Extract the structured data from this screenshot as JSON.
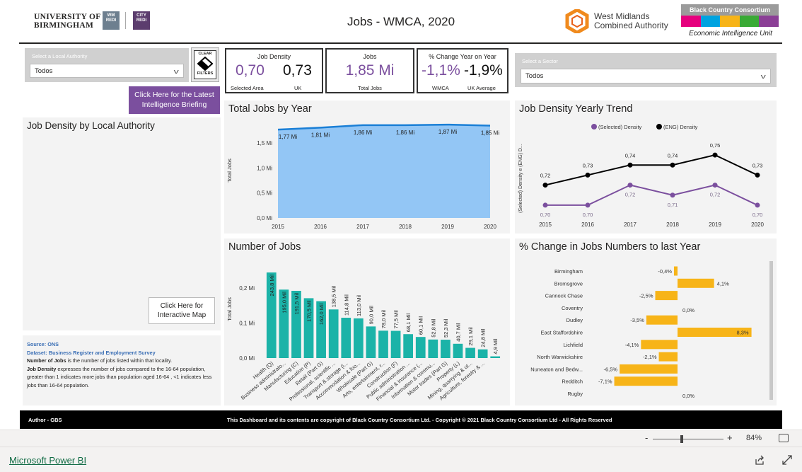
{
  "header": {
    "uob_line1": "UNIVERSITY OF",
    "uob_line2": "BIRMINGHAM",
    "wm_redi": "WM REDI",
    "city_redi": "CITY REDI",
    "title": "Jobs - WMCA, 2020",
    "wmca_line1": "West Midlands",
    "wmca_line2": "Combined Authority",
    "bcc_name": "Black Country Consortium",
    "bcc_unit": "Economic Intelligence Unit",
    "bcc_colors": [
      "#e6007e",
      "#00a3e0",
      "#f7b418",
      "#3aaa35",
      "#8b3f96"
    ]
  },
  "slicers": {
    "authority_label": "Select a Local Authority",
    "authority_value": "Todos",
    "sector_label": "Select a Sector",
    "sector_value": "Todos",
    "clear_top": "CLEAR",
    "clear_bottom": "FILTERS"
  },
  "briefing_button": "Click Here for the Latest Intelligence Briefing",
  "cards": {
    "density": {
      "title": "Job Density",
      "selected": "0,70",
      "uk": "0,73",
      "selected_label": "Selected Area",
      "uk_label": "UK"
    },
    "jobs": {
      "title": "Jobs",
      "value": "1,85 Mi",
      "label": "Total Jobs"
    },
    "change": {
      "title": "% Change Year on Year",
      "wmca": "-1,1%",
      "uk": "-1,9%",
      "wmca_label": "WMCA",
      "uk_label": "UK Average"
    }
  },
  "panels": {
    "density_by_la": "Job Density by Local Authority",
    "map_button": "Click Here for Interactive Map",
    "total_jobs": "Total Jobs by Year",
    "density_trend": "Job Density Yearly Trend",
    "number_jobs": "Number of Jobs",
    "pct_change": "% Change in Jobs Numbers to last Year"
  },
  "notes": {
    "source": "Source: ONS",
    "dataset": "Dataset: Business Register and Employment Survey",
    "jobs_term": "Number of Jobs",
    "jobs_text": "is the number of jobs listed within that locality.",
    "density_term": "Job Density",
    "density_text": "expresses the number of jobs compared to the 16-64 population, greater than 1 indicates more jobs than population aged 16-64 , <1 indicates less jobs than 16-64 population."
  },
  "footer": {
    "author": "Author - GBS",
    "copyright": "This Dashboard and its contents are copyright of Black Country Consortium Ltd.  -  Copyright © 2021 Black Country Consortium Ltd - All Rights Reserved"
  },
  "pbi": {
    "zoom": "84%",
    "link": "Microsoft Power BI",
    "minus": "-",
    "plus": "+"
  },
  "colors": {
    "purple": "#7b4f9e",
    "area": "#93c6f5",
    "areaLine": "#1a7fd6",
    "teal": "#1bb3a8",
    "orange": "#f7b418",
    "black": "#000000"
  },
  "chart_data": [
    {
      "id": "total_jobs",
      "type": "area",
      "title": "Total Jobs by Year",
      "ylabel": "Total Jobs",
      "x": [
        "2015",
        "2016",
        "2017",
        "2018",
        "2019",
        "2020"
      ],
      "values": [
        1.77,
        1.81,
        1.86,
        1.86,
        1.87,
        1.85
      ],
      "value_labels": [
        "1,77 Mi",
        "1,81 Mi",
        "1,86 Mi",
        "1,86 Mi",
        "1,87 Mi",
        "1,85 Mi"
      ],
      "yticks": [
        "0,0 Mi",
        "0,5 Mi",
        "1,0 Mi",
        "1,5 Mi"
      ],
      "ylim": [
        0,
        1.9
      ]
    },
    {
      "id": "density_trend",
      "type": "line",
      "title": "Job Density Yearly Trend",
      "ylabel": "(Selected) Density e (ENG) D...",
      "x": [
        "2015",
        "2016",
        "2017",
        "2018",
        "2019",
        "2020"
      ],
      "series": [
        {
          "name": "(Selected) Density",
          "values": [
            0.7,
            0.7,
            0.72,
            0.71,
            0.72,
            0.7
          ],
          "labels": [
            "0,70",
            "0,70",
            "0,72",
            "0,71",
            "0,72",
            "0,70"
          ]
        },
        {
          "name": "(ENG) Density",
          "values": [
            0.72,
            0.73,
            0.74,
            0.74,
            0.75,
            0.73
          ],
          "labels": [
            "0,72",
            "0,73",
            "0,74",
            "0,74",
            "0,75",
            "0,73"
          ]
        }
      ],
      "legend": "top"
    },
    {
      "id": "number_jobs",
      "type": "bar",
      "title": "Number of Jobs",
      "ylabel": "Total Jobs",
      "categories": [
        "Health (Q)",
        "Business administrato...",
        "Manufacturing (C)",
        "Education (P)",
        "Retail (Part G)",
        "Professional, scientific ...",
        "Transport & storage (i...",
        "Accommodation & foo...",
        "Wholesale (Part G)",
        "Arts, entertainment, r...",
        "Construction (F)",
        "Public administration ...",
        "Financial & insurance (...",
        "Information & commu...",
        "Motor trades (Part G)",
        "Property (L)",
        "Mining, quarrying & ut...",
        "Agriculture, forestry & ..."
      ],
      "values": [
        243.8,
        195.0,
        191.5,
        170.5,
        162.0,
        138.5,
        114.8,
        113.0,
        90.0,
        78.0,
        77.5,
        68.1,
        60.1,
        52.8,
        52.3,
        40.7,
        29.1,
        24.8,
        4.9
      ],
      "value_labels": [
        "243,8 Mil",
        "195,0 Mil",
        "191,5 Mil",
        "170,5 Mil",
        "162,0 Mil",
        "138,5 Mil",
        "114,8 Mil",
        "113,0 Mil",
        "90,0 Mil",
        "78,0 Mil",
        "77,5 Mil",
        "68,1 Mil",
        "60,1 Mil",
        "52,8 Mil",
        "52,3 Mil",
        "40,7 Mil",
        "29,1 Mil",
        "24,8 Mil",
        "4,9 Mil"
      ],
      "yticks": [
        "0,0 Mi",
        "0,1 Mi",
        "0,2 Mi"
      ],
      "ylim": [
        0,
        0.26
      ]
    },
    {
      "id": "pct_change",
      "type": "bar",
      "orientation": "horizontal",
      "title": "% Change in Jobs Numbers to last Year",
      "categories": [
        "Birmingham",
        "Bromsgrove",
        "Cannock Chase",
        "Coventry",
        "Dudley",
        "East Staffordshire",
        "Lichfield",
        "North Warwickshire",
        "Nuneaton and Bedw...",
        "Redditch",
        "Rugby"
      ],
      "values": [
        -0.4,
        4.1,
        -2.5,
        0.0,
        -3.5,
        8.3,
        -4.1,
        -2.1,
        -6.5,
        -7.1,
        0.0
      ],
      "value_labels": [
        "-0,4%",
        "4,1%",
        "-2,5%",
        "0,0%",
        "-3,5%",
        "8,3%",
        "-4,1%",
        "-2,1%",
        "-6,5%",
        "-7,1%",
        "0,0%"
      ]
    }
  ]
}
